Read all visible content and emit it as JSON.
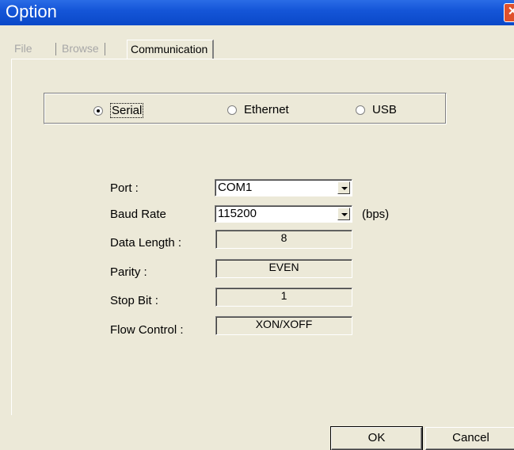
{
  "window": {
    "title": "Option",
    "close_glyph": "✕"
  },
  "tabs": [
    {
      "label": "File",
      "active": false
    },
    {
      "label": "Browse",
      "active": false
    },
    {
      "label": "Communication",
      "active": true
    }
  ],
  "connection": {
    "options": [
      {
        "label": "Serial",
        "selected": true
      },
      {
        "label": "Ethernet",
        "selected": false
      },
      {
        "label": "USB",
        "selected": false
      }
    ]
  },
  "fields": {
    "port": {
      "label": "Port :",
      "value": "COM1"
    },
    "baud_rate": {
      "label": "Baud Rate",
      "value": "115200",
      "unit": "(bps)"
    },
    "data_length": {
      "label": "Data Length :",
      "value": "8"
    },
    "parity": {
      "label": "Parity :",
      "value": "EVEN"
    },
    "stop_bit": {
      "label": "Stop Bit :",
      "value": "1"
    },
    "flow_control": {
      "label": "Flow Control :",
      "value": "XON/XOFF"
    }
  },
  "buttons": {
    "ok": "OK",
    "cancel": "Cancel"
  }
}
